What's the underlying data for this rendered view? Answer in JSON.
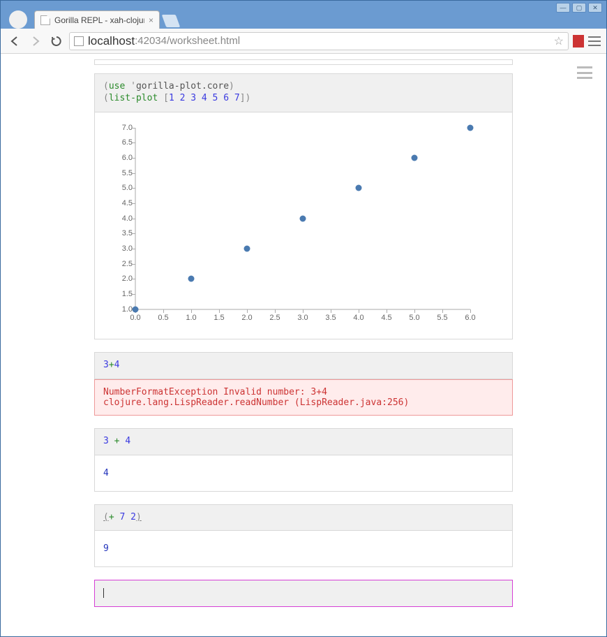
{
  "window": {
    "title": "Gorilla REPL - xah-clojur"
  },
  "url": {
    "host": "localhost",
    "port_path": ":42034/worksheet.html"
  },
  "cells": [
    {
      "input_tokens": [
        {
          "t": "paren",
          "v": "("
        },
        {
          "t": "kw",
          "v": "use"
        },
        {
          "t": "sym",
          "v": " "
        },
        {
          "t": "quote",
          "v": "'"
        },
        {
          "t": "sym",
          "v": "gorilla-plot.core"
        },
        {
          "t": "paren",
          "v": ")"
        },
        {
          "t": "nl"
        },
        {
          "t": "paren",
          "v": "("
        },
        {
          "t": "kw",
          "v": "list-plot"
        },
        {
          "t": "sym",
          "v": " "
        },
        {
          "t": "paren",
          "v": "["
        },
        {
          "t": "num",
          "v": "1 2 3 4 5 6 7"
        },
        {
          "t": "paren",
          "v": "]"
        },
        {
          "t": "paren",
          "v": ")"
        }
      ],
      "raw_input": "(use 'gorilla-plot.core)\n(list-plot [1 2 3 4 5 6 7])",
      "output_type": "plot"
    },
    {
      "input_tokens": [
        {
          "t": "num",
          "v": "3"
        },
        {
          "t": "kw",
          "v": "+"
        },
        {
          "t": "num",
          "v": "4"
        }
      ],
      "raw_input": "3+4",
      "output_type": "error",
      "output_text": "NumberFormatException Invalid number: 3+4\nclojure.lang.LispReader.readNumber (LispReader.java:256)"
    },
    {
      "input_tokens": [
        {
          "t": "num",
          "v": "3"
        },
        {
          "t": "sym",
          "v": " "
        },
        {
          "t": "kw",
          "v": "+"
        },
        {
          "t": "sym",
          "v": " "
        },
        {
          "t": "num",
          "v": "4"
        }
      ],
      "raw_input": "3 + 4",
      "output_type": "value",
      "output_text": "4"
    },
    {
      "input_tokens": [
        {
          "t": "paren underline",
          "v": "("
        },
        {
          "t": "kw",
          "v": "+"
        },
        {
          "t": "sym",
          "v": " "
        },
        {
          "t": "num",
          "v": "7"
        },
        {
          "t": "sym",
          "v": " "
        },
        {
          "t": "num",
          "v": "2"
        },
        {
          "t": "paren underline",
          "v": ")"
        }
      ],
      "raw_input": "(+ 7 2)",
      "output_type": "value",
      "output_text": "9"
    },
    {
      "input_tokens": [],
      "raw_input": "",
      "output_type": "none",
      "active": true
    }
  ],
  "chart_data": {
    "type": "scatter",
    "x": [
      0,
      1,
      2,
      3,
      4,
      5,
      6
    ],
    "y": [
      1,
      2,
      3,
      4,
      5,
      6,
      7
    ],
    "xlim": [
      0,
      6.0
    ],
    "ylim": [
      1.0,
      7.0
    ],
    "xticks": [
      0.0,
      0.5,
      1.0,
      1.5,
      2.0,
      2.5,
      3.0,
      3.5,
      4.0,
      4.5,
      5.0,
      5.5,
      6.0
    ],
    "yticks": [
      1.0,
      1.5,
      2.0,
      2.5,
      3.0,
      3.5,
      4.0,
      4.5,
      5.0,
      5.5,
      6.0,
      6.5,
      7.0
    ],
    "title": "",
    "xlabel": "",
    "ylabel": ""
  }
}
